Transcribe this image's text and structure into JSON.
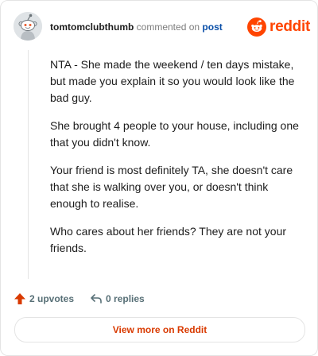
{
  "header": {
    "username": "tomtomclubthumb",
    "action_text": "commented on",
    "post_link": "post",
    "brand": "reddit"
  },
  "comment": {
    "paragraphs": [
      "NTA - She made the weekend / ten days mistake, but made you explain it so you would look like the bad guy.",
      "She brought 4 people to your house, including one that you didn't know.",
      "Your friend is most definitely TA, she doesn't care that she is walking over you, or doesn't think enough to realise.",
      "Who cares about her friends? They are not your friends."
    ]
  },
  "actions": {
    "upvotes": "2 upvotes",
    "replies": "0 replies"
  },
  "view_more_label": "View more on Reddit",
  "colors": {
    "brand": "#ff4500",
    "upvote_arrow": "#d93a00",
    "link": "#0a4fa8",
    "view_more_text": "#d93a00"
  },
  "icons": {
    "avatar": "snoo-avatar",
    "logo": "reddit-logo",
    "upvote": "upvote-arrow-icon",
    "reply": "reply-arrow-icon"
  }
}
